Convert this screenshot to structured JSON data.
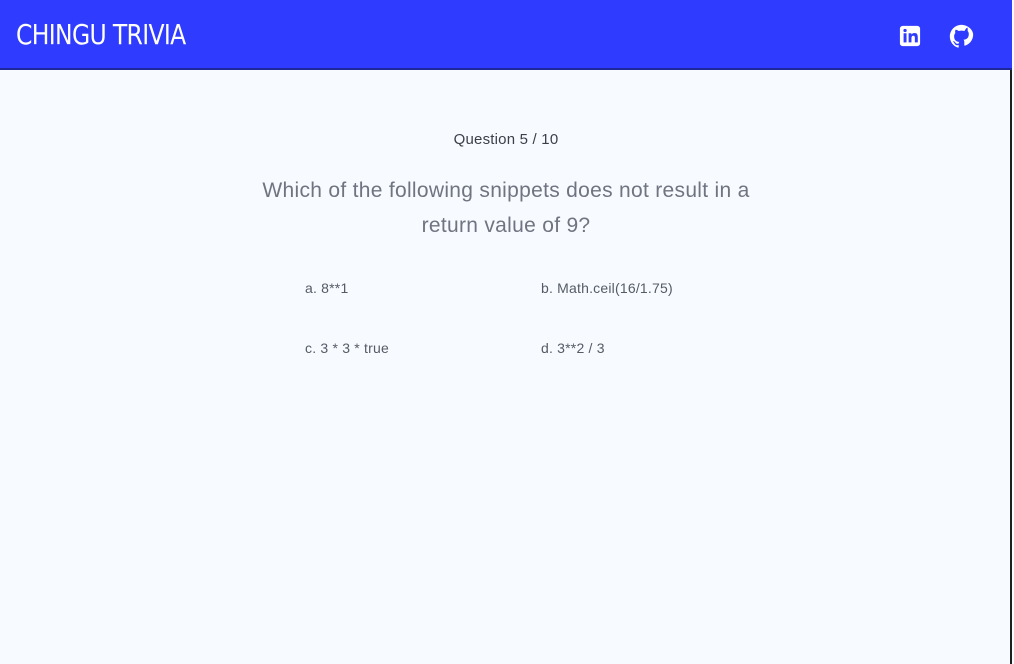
{
  "app": {
    "title": "CHINGU TRIVIA",
    "colors": {
      "header": "#2f3cff",
      "background": "#f7fbff",
      "text": "#6f7480",
      "header_text": "#ffffff"
    }
  },
  "header": {
    "icons": [
      {
        "name": "linkedin-icon"
      },
      {
        "name": "github-icon"
      }
    ]
  },
  "quiz": {
    "counter": "Question 5 / 10",
    "question": "Which of the following snippets does not result in a return value of 9?",
    "answers": [
      "a. 8**1",
      "b. Math.ceil(16/1.75)",
      "c. 3 * 3 * true",
      "d. 3**2 / 3"
    ]
  }
}
